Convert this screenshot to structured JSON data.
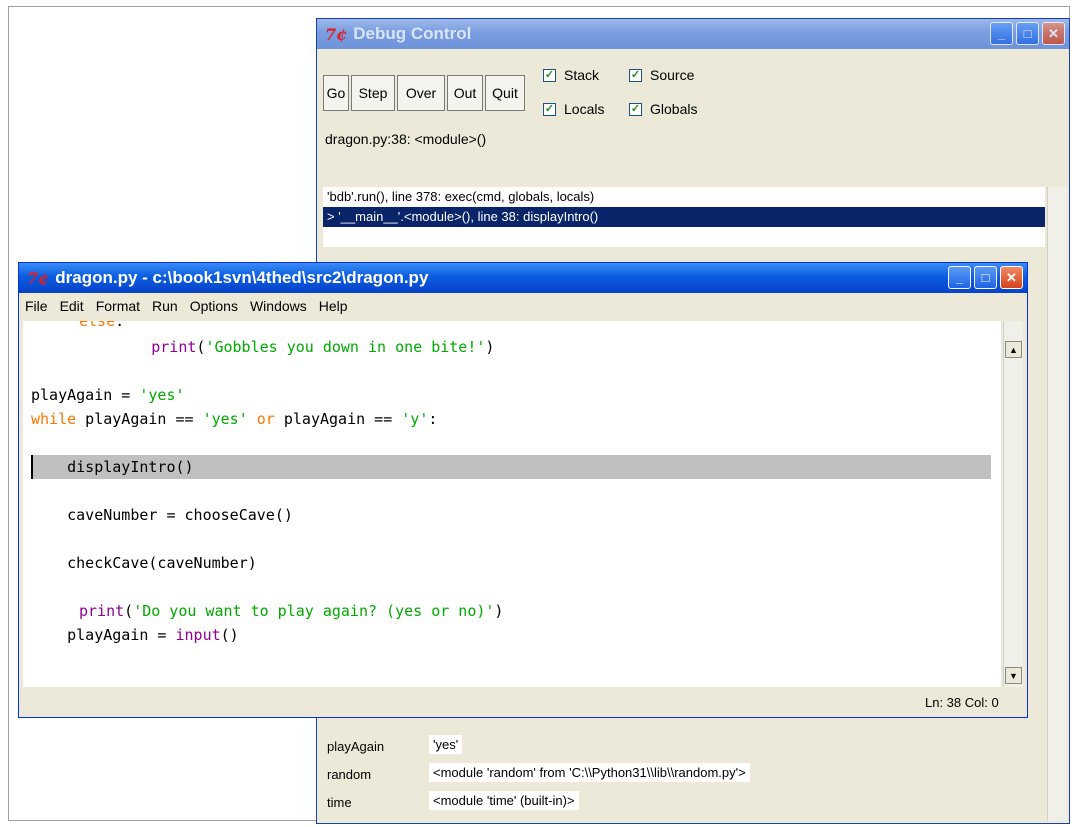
{
  "debug": {
    "title": "Debug Control",
    "buttons": [
      "Go",
      "Step",
      "Over",
      "Out",
      "Quit"
    ],
    "checks": {
      "stack": "Stack",
      "source": "Source",
      "locals": "Locals",
      "globals": "Globals"
    },
    "location": "dragon.py:38: <module>()",
    "stack": [
      "'bdb'.run(), line 378: exec(cmd, globals, locals)",
      "> '__main__'.<module>(), line 38: displayIntro()"
    ],
    "vars": [
      {
        "name": "playAgain",
        "value": "'yes'"
      },
      {
        "name": "random",
        "value": "<module 'random' from 'C:\\\\Python31\\\\lib\\\\random.py'>"
      },
      {
        "name": "time",
        "value": "<module 'time' (built-in)>"
      }
    ]
  },
  "editor": {
    "title": "dragon.py - c:\\book1svn\\4thed\\src2\\dragon.py",
    "menu": [
      "File",
      "Edit",
      "Format",
      "Run",
      "Options",
      "Windows",
      "Help"
    ],
    "lines": {
      "l0": "else",
      "l0b": ":",
      "l1a": "        ",
      "l1b": "print",
      "l1c": "(",
      "l1d": "'Gobbles you down in one bite!'",
      "l1e": ")",
      "l2a": "playAgain = ",
      "l2b": "'yes'",
      "l3a": "while",
      "l3b": " playAgain == ",
      "l3c": "'yes'",
      "l3d": " or",
      "l3e": " playAgain == ",
      "l3f": "'y'",
      "l3g": ":",
      "l4": "    displayIntro()",
      "l5": "    caveNumber = chooseCave()",
      "l6": "    checkCave(caveNumber)",
      "l7a": "print",
      "l7b": "(",
      "l7c": "'Do you want to play again? (yes or no)'",
      "l7d": ")",
      "l8a": "    playAgain = ",
      "l8b": "input",
      "l8c": "()"
    },
    "status": "Ln: 38 Col: 0"
  },
  "window_buttons": {
    "min": "_",
    "max": "□",
    "close": "✕"
  },
  "icon": "7¢"
}
